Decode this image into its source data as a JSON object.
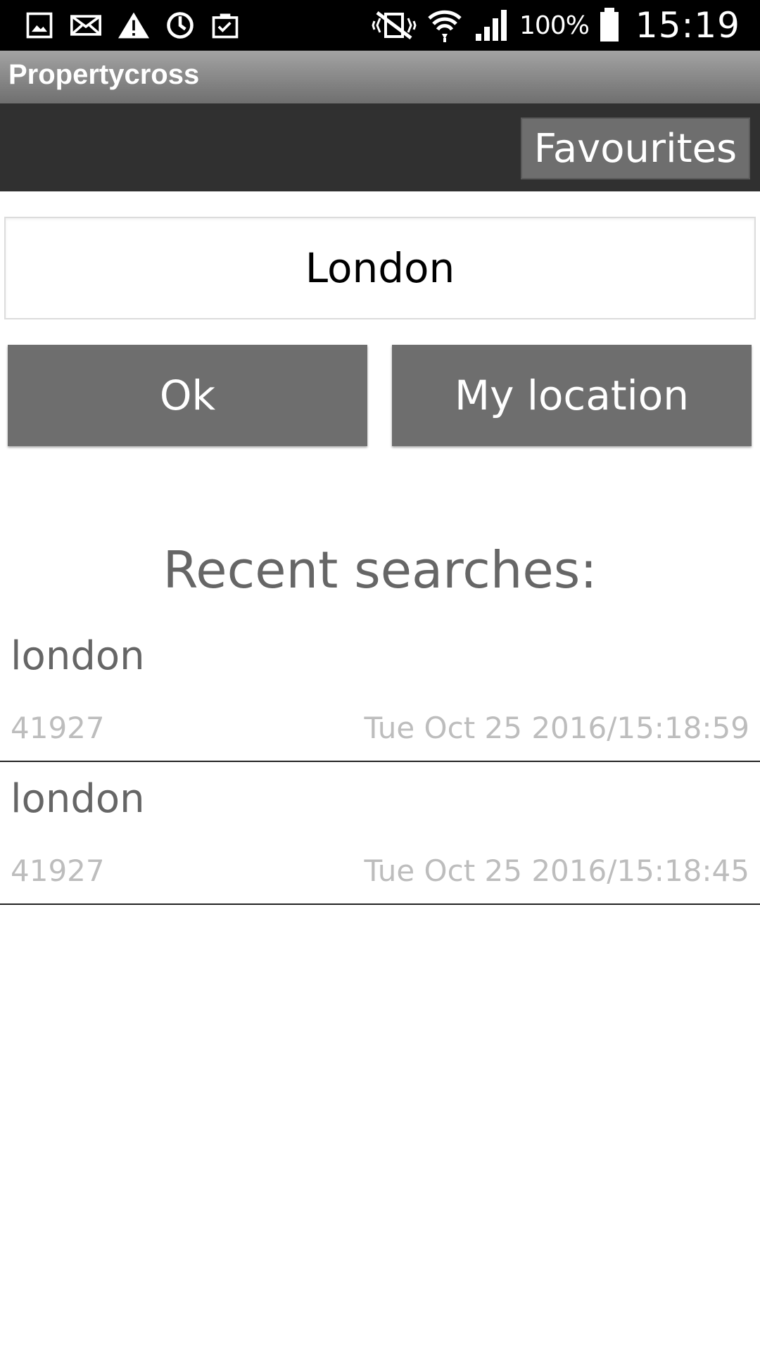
{
  "status_bar": {
    "left_icons": [
      "gallery-icon",
      "mail-icon",
      "warning-icon",
      "sync-icon",
      "clipboard-icon"
    ],
    "right_icons": [
      "vibrate-icon",
      "wifi-icon",
      "signal-icon",
      "battery-icon"
    ],
    "battery": "100%",
    "time": "15:19"
  },
  "app": {
    "title": "Propertycross"
  },
  "header": {
    "favourites_label": "Favourites"
  },
  "search": {
    "value": "London"
  },
  "buttons": {
    "ok_label": "Ok",
    "location_label": "My location"
  },
  "recent": {
    "heading": "Recent searches:",
    "items": [
      {
        "name": "london",
        "count": "41927",
        "date": "Tue Oct 25 2016/15:18:59"
      },
      {
        "name": "london",
        "count": "41927",
        "date": "Tue Oct 25 2016/15:18:45"
      }
    ]
  },
  "colors": {
    "status_bar_bg": "#000000",
    "header_bg": "#303030",
    "button_bg": "#6e6e6e",
    "heading_text": "#666666",
    "meta_text": "#bdbdbd"
  }
}
